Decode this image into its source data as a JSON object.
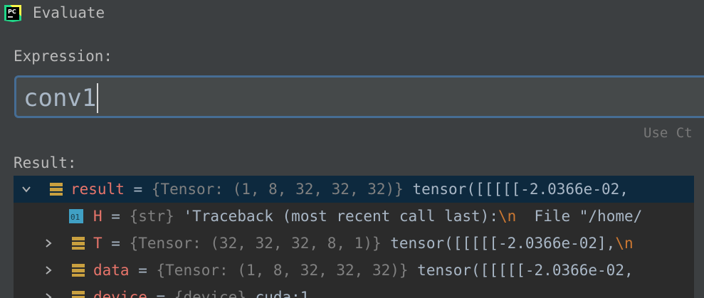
{
  "window": {
    "title": "Evaluate",
    "logo_text": "PC"
  },
  "expression": {
    "label": "Expression:",
    "value": "conv1"
  },
  "hint": "Use Ct",
  "result": {
    "label": "Result:",
    "rows": [
      {
        "expanded": true,
        "name": "result",
        "eq": " = ",
        "type": "{Tensor: (1, 8, 32, 32, 32)}",
        "value": " tensor([[[[[-2.0366e-02,",
        "icon": "field-icon"
      },
      {
        "name": "H",
        "eq": " = ",
        "type": "{str}",
        "value": " 'Traceback (most recent call last):",
        "esc": "\\n",
        "value2": "  File \"/home/",
        "icon": "string-icon"
      },
      {
        "expanded": false,
        "name": "T",
        "eq": " = ",
        "type": "{Tensor: (32, 32, 32, 8, 1)}",
        "value": " tensor([[[[[-2.0366e-02],",
        "esc": "\\n",
        "icon": "field-icon"
      },
      {
        "expanded": false,
        "name": "data",
        "eq": " = ",
        "type": "{Tensor: (1, 8, 32, 32, 32)}",
        "value": " tensor([[[[[-2.0366e-02,",
        "icon": "field-icon"
      },
      {
        "expanded": false,
        "name": "device",
        "eq": " = ",
        "type": "{device}",
        "value": " cuda:1",
        "icon": "field-icon"
      }
    ]
  }
}
